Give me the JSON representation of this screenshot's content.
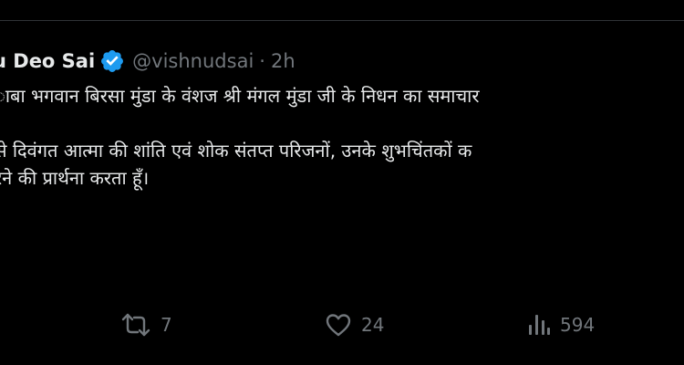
{
  "tweet": {
    "author": {
      "display_name": "u Deo Sai",
      "handle": "@vishnudsai",
      "separator": "·",
      "time": "2h"
    },
    "body_lines": [
      "ाबा भगवान बिरसा मुंडा के वंशज श्री मंगल मुंडा जी के निधन का समाचार",
      "",
      "से दिवंगत आत्मा की शांति एवं शोक संतप्त परिजनों, उनके शुभचिंतकों क",
      "रने की प्रार्थना करता हूँ।",
      "",
      "",
      "!"
    ],
    "actions": {
      "retweets": "7",
      "likes": "24",
      "views": "594"
    }
  },
  "colors": {
    "background": "#000000",
    "text_primary": "#e7e9ea",
    "text_secondary": "#71767b",
    "verified_badge": "#1d9bf0",
    "divider": "#2f3336"
  },
  "icons": {
    "verified": "verified-badge-icon",
    "retweet": "retweet-icon",
    "like": "heart-icon",
    "views": "views-chart-icon"
  }
}
